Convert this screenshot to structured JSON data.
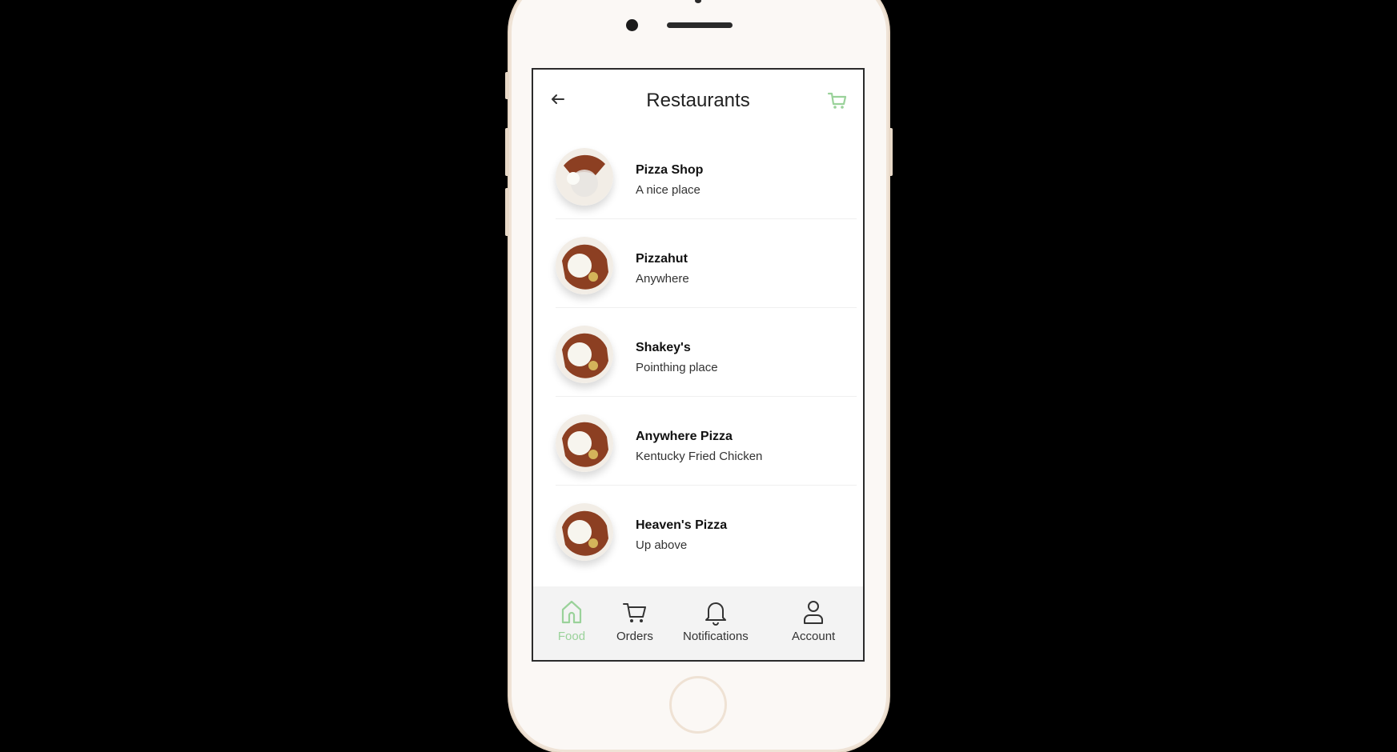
{
  "header": {
    "title": "Restaurants",
    "back_icon": "back-arrow-icon",
    "cart_icon": "cart-icon"
  },
  "restaurants": [
    {
      "name": "Pizza Shop",
      "description": "A nice place"
    },
    {
      "name": "Pizzahut",
      "description": "Anywhere"
    },
    {
      "name": "Shakey's",
      "description": "Pointhing place"
    },
    {
      "name": "Anywhere Pizza",
      "description": "Kentucky Fried Chicken"
    },
    {
      "name": "Heaven's Pizza",
      "description": "Up above"
    }
  ],
  "tabs": [
    {
      "label": "Food",
      "icon": "home-icon",
      "active": true
    },
    {
      "label": "Orders",
      "icon": "cart-icon",
      "active": false
    },
    {
      "label": "Notifications",
      "icon": "bell-icon",
      "active": false
    },
    {
      "label": "Account",
      "icon": "user-icon",
      "active": false
    }
  ],
  "colors": {
    "accent": "#9ad29a",
    "background": "#000000",
    "phone_body": "#fbf8f5"
  }
}
